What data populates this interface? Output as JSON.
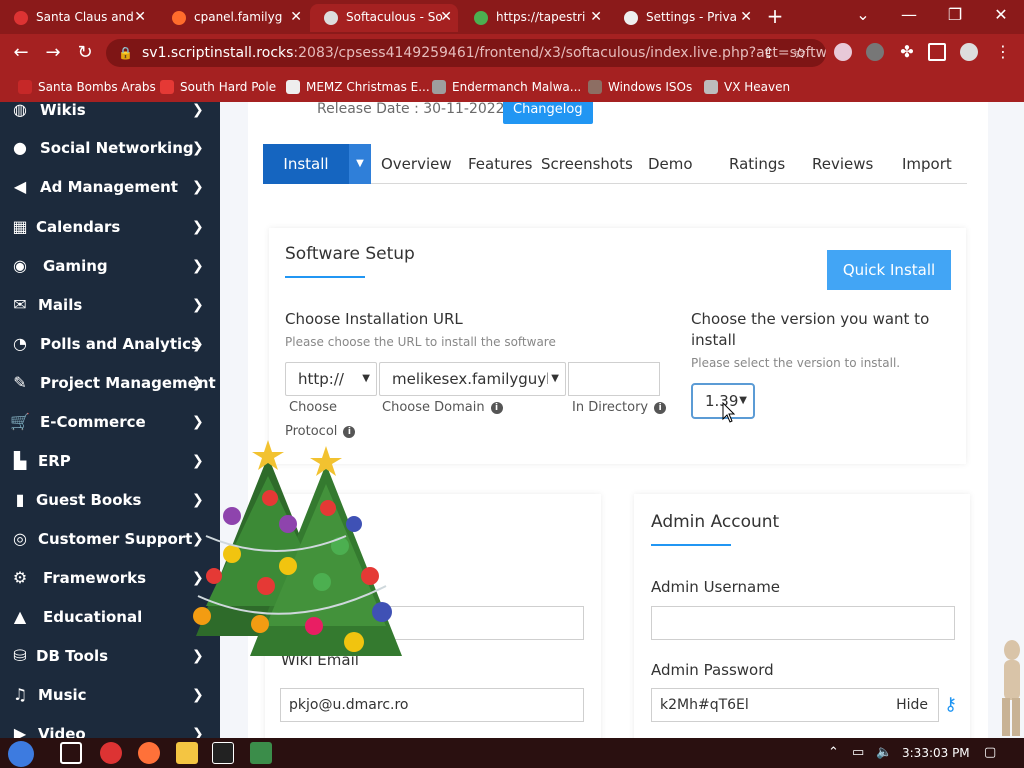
{
  "browser": {
    "tabs": [
      {
        "title": "Santa Claus and",
        "favicon_color": "#d33"
      },
      {
        "title": "cpanel.familyg",
        "favicon_color": "#ff6c2c"
      },
      {
        "title": "Softaculous - So",
        "favicon_color": "#ddd"
      },
      {
        "title": "https://tapestri",
        "favicon_color": "#4caf50"
      },
      {
        "title": "Settings - Priva",
        "favicon_color": "#eee"
      }
    ],
    "url_host": "sv1.scriptinstall.rocks",
    "url_path": ":2083/cpsess4149259461/frontend/x3/softaculous/index.live.php?act=softw...",
    "bookmarks": [
      {
        "label": "Santa Bombs Arabs",
        "icon_color": "#c62828"
      },
      {
        "label": "South Hard Pole",
        "icon_color": "#e53935"
      },
      {
        "label": "MEMZ Christmas E...",
        "icon_color": "#eeeeee"
      },
      {
        "label": "Endermanch Malwa...",
        "icon_color": "#9e9e9e"
      },
      {
        "label": "Windows ISOs",
        "icon_color": "#8d6e63"
      },
      {
        "label": "VX Heaven",
        "icon_color": "#bdbdbd"
      }
    ]
  },
  "sidebar": {
    "items": [
      {
        "label": "Wikis",
        "icon": "globe-icon"
      },
      {
        "label": "Social Networking",
        "icon": "chat-icon"
      },
      {
        "label": "Ad Management",
        "icon": "megaphone-icon"
      },
      {
        "label": "Calendars",
        "icon": "calendar-icon"
      },
      {
        "label": "Gaming",
        "icon": "gamepad-icon"
      },
      {
        "label": "Mails",
        "icon": "envelope-icon"
      },
      {
        "label": "Polls and Analytics",
        "icon": "pie-chart-icon"
      },
      {
        "label": "Project Management",
        "icon": "edit-icon"
      },
      {
        "label": "E-Commerce",
        "icon": "cart-icon"
      },
      {
        "label": "ERP",
        "icon": "bar-chart-icon"
      },
      {
        "label": "Guest Books",
        "icon": "book-icon"
      },
      {
        "label": "Customer Support",
        "icon": "lifebuoy-icon"
      },
      {
        "label": "Frameworks",
        "icon": "gears-icon"
      },
      {
        "label": "Educational",
        "icon": "graduation-cap-icon"
      },
      {
        "label": "DB Tools",
        "icon": "database-icon"
      },
      {
        "label": "Music",
        "icon": "music-icon"
      },
      {
        "label": "Video",
        "icon": "video-icon"
      }
    ]
  },
  "header": {
    "release_label": "Release Date : 30-11-2022",
    "changelog": "Changelog"
  },
  "tabs": {
    "install": "Install",
    "items": [
      "Overview",
      "Features",
      "Screenshots",
      "Demo",
      "Ratings",
      "Reviews",
      "Import"
    ]
  },
  "setup": {
    "title": "Software Setup",
    "quick_install": "Quick Install",
    "url_label": "Choose Installation URL",
    "url_hint": "Please choose the URL to install the software",
    "protocol_value": "http://",
    "domain_value": "melikesex.familyguyh",
    "directory_value": "",
    "protocol_label_1": "Choose",
    "protocol_label_2": "Protocol",
    "domain_label": "Choose Domain",
    "directory_label": "In Directory",
    "version_label_1": "Choose the version you want to",
    "version_label_2": "install",
    "version_hint": "Please select the version to install.",
    "version_value": "1.39"
  },
  "site_settings": {
    "wiki_email_label": "Wiki Email",
    "wiki_email_value": "pkjo@u.dmarc.ro"
  },
  "admin": {
    "title": "Admin Account",
    "username_label": "Admin Username",
    "username_value": "",
    "password_label": "Admin Password",
    "password_value": "k2Mh#qT6El",
    "hide_label": "Hide"
  },
  "taskbar": {
    "clock": "3:33:03 PM"
  },
  "colors": {
    "browser_frame": "#a52121",
    "sidebar_bg": "#1c2a3c",
    "accent_blue": "#2196f3",
    "install_blue": "#1565c0"
  }
}
